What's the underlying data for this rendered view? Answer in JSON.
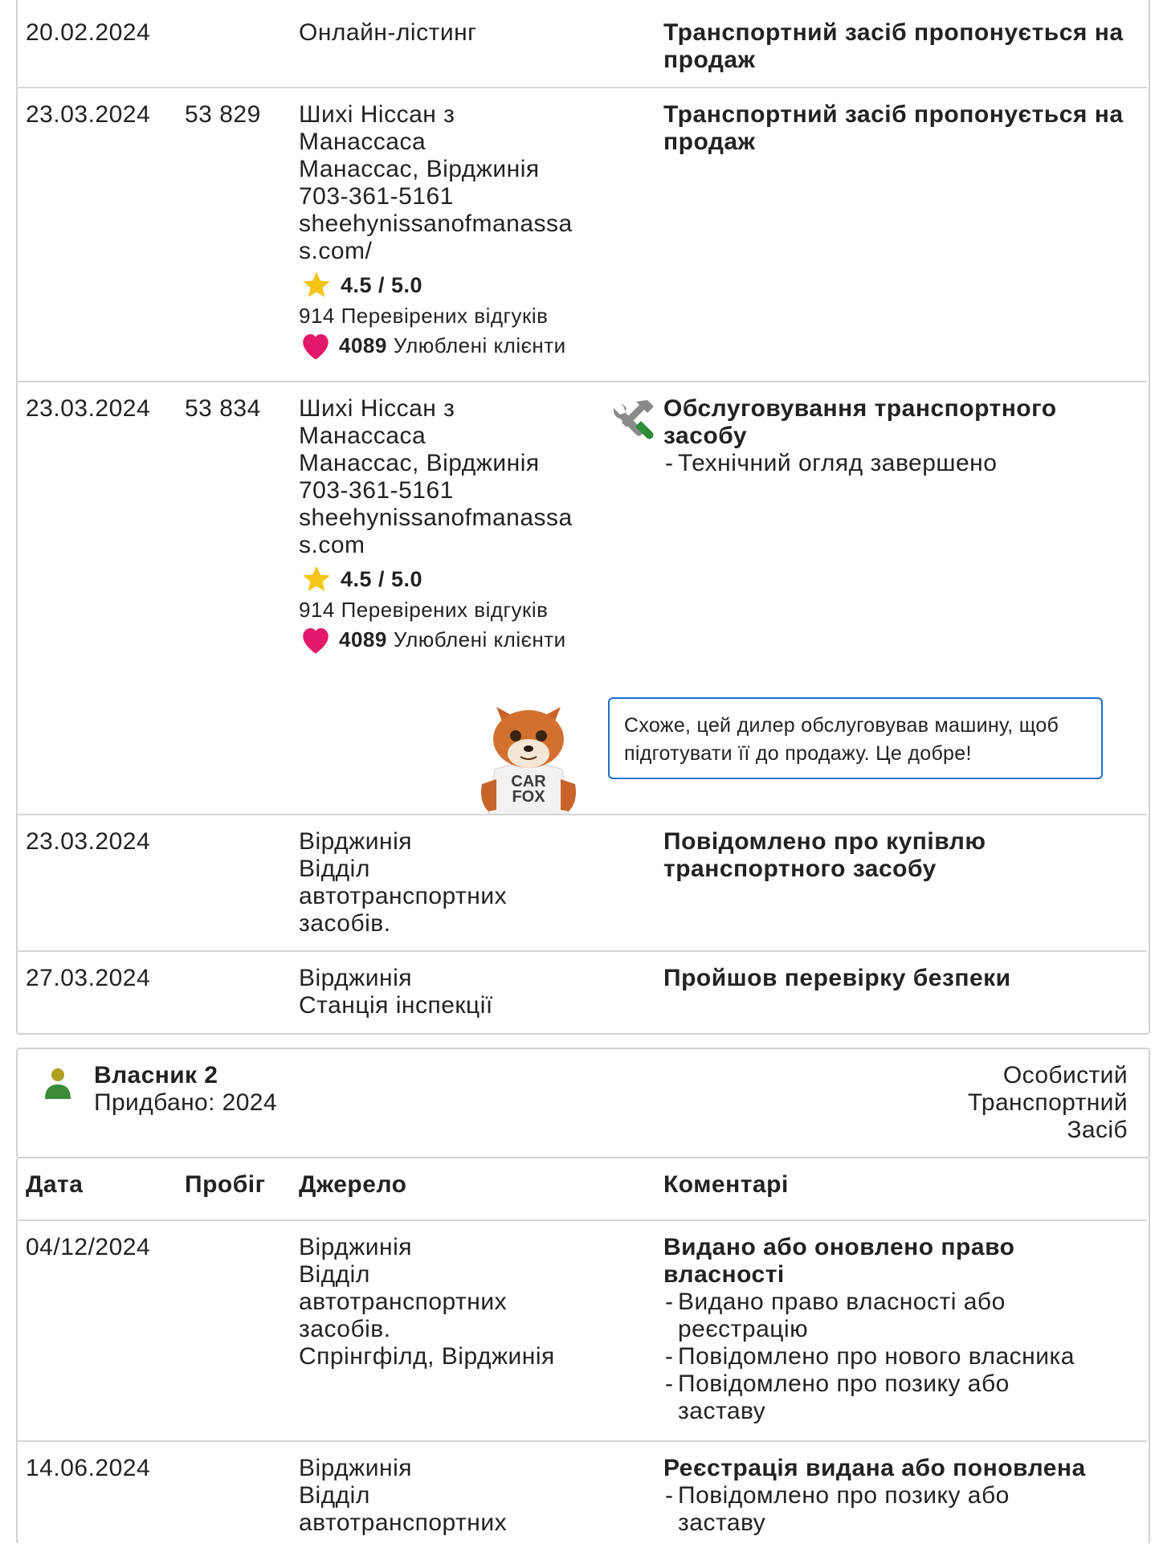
{
  "owner1_records": [
    {
      "date": "20.02.2024",
      "odometer": "",
      "source_lines": [
        "Онлайн-лістинг"
      ],
      "comment_title_lines": [
        "Транспортний засіб пропонується на",
        "продаж"
      ],
      "comment_bullets": []
    },
    {
      "date": "23.03.2024",
      "odometer": "53 829",
      "source_lines": [
        "Шихі Ніссан з",
        "Манассаса",
        "Манассас, Вірджинія",
        "703-361-5161",
        "sheehynissanofmanassa",
        "s.com/"
      ],
      "rating": "4.5 / 5.0",
      "reviews": "914 Перевірених відгуків",
      "favorites_count": "4089",
      "favorites_label": "Улюблені клієнти",
      "comment_title_lines": [
        "Транспортний засіб пропонується на",
        "продаж"
      ],
      "comment_bullets": []
    },
    {
      "date": "23.03.2024",
      "odometer": "53 834",
      "source_lines": [
        "Шихі Ніссан з",
        "Манассаса",
        "Манассас, Вірджинія",
        "703-361-5161",
        "sheehynissanofmanassa",
        "s.com"
      ],
      "rating": "4.5 / 5.0",
      "reviews": "914 Перевірених відгуків",
      "favorites_count": "4089",
      "favorites_label": "Улюблені клієнти",
      "icon": "service-tools-icon",
      "comment_title_lines": [
        "Обслуговування транспортного",
        "засобу"
      ],
      "comment_bullets": [
        "Технічний огляд завершено"
      ]
    },
    {
      "date": "23.03.2024",
      "odometer": "",
      "source_lines": [
        "Вірджинія",
        "Відділ",
        "автотранспортних",
        "засобів."
      ],
      "comment_title_lines": [
        "Повідомлено про купівлю",
        "транспортного засобу"
      ],
      "comment_bullets": []
    },
    {
      "date": "27.03.2024",
      "odometer": "",
      "source_lines": [
        "Вірджинія",
        "Станція інспекції"
      ],
      "comment_title_lines": [
        "Пройшов перевірку безпеки"
      ],
      "comment_bullets": []
    }
  ],
  "carfox_tip": {
    "lines": [
      "Схоже, цей дилер обслуговував машину, щоб",
      "підготувати її до продажу. Це добре!"
    ],
    "mascot_shirt": [
      "CAR",
      "FOX"
    ]
  },
  "owner2": {
    "title": "Власник 2",
    "purchased": "Придбано: 2024",
    "type_lines": [
      "Особистий",
      "Транспортний",
      "Засіб"
    ],
    "icon": "person-icon",
    "icon_color": "#3a8a3a",
    "headers": {
      "date": "Дата",
      "odometer": "Пробіг",
      "source": "Джерело",
      "comments": "Коментарі"
    },
    "records": [
      {
        "date": "04/12/2024",
        "odometer": "",
        "source_lines": [
          "Вірджинія",
          "Відділ",
          "автотранспортних",
          "засобів.",
          "Спрінгфілд, Вірджинія"
        ],
        "comment_title_lines": [
          "Видано або оновлено право",
          "власності"
        ],
        "comment_bullets": [
          [
            "Видано право власності або",
            "реєстрацію"
          ],
          [
            "Повідомлено про нового власника"
          ],
          [
            "Повідомлено про позику або",
            "заставу"
          ]
        ]
      },
      {
        "date": "14.06.2024",
        "odometer": "",
        "source_lines": [
          "Вірджинія",
          "Відділ",
          "автотранспортних"
        ],
        "comment_title_lines": [
          "Реєстрація видана або поновлена"
        ],
        "comment_bullets": [
          [
            "Повідомлено про позику або",
            "заставу"
          ]
        ]
      }
    ]
  },
  "colors": {
    "star": "#f5c518",
    "heart": "#e4186a",
    "tip_border": "#1a6fd0",
    "tools_green": "#2e8b3a",
    "border": "#d3d3d3"
  }
}
